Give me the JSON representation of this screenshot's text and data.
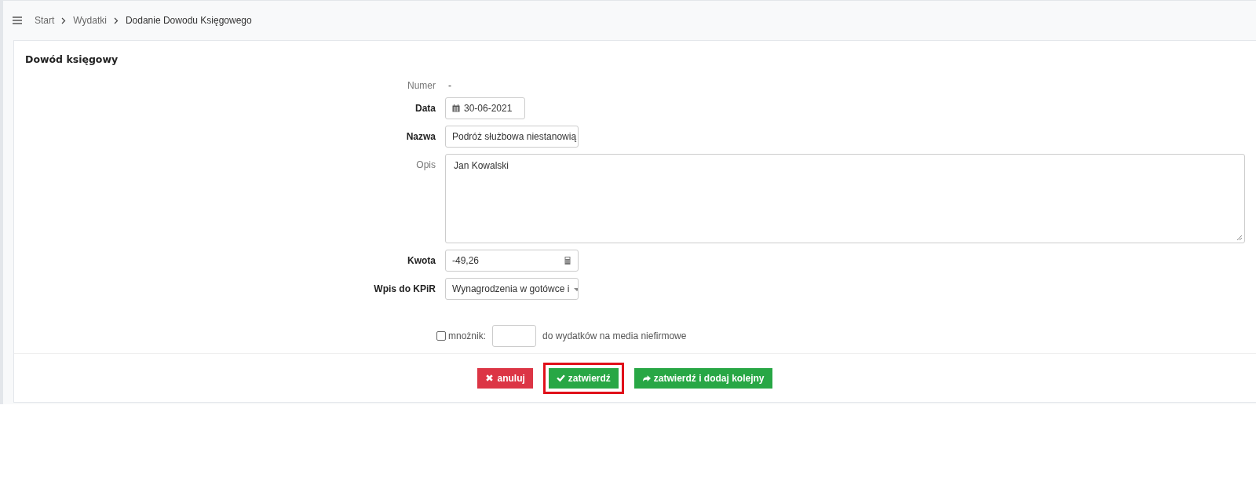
{
  "breadcrumb": [
    {
      "label": "Start",
      "current": false
    },
    {
      "label": "Wydatki",
      "current": false
    },
    {
      "label": "Dodanie Dowodu Księgowego",
      "current": true
    }
  ],
  "card": {
    "title": "Dowód księgowy",
    "fields": [
      {
        "kind": "static",
        "label": "Numer",
        "required": false,
        "value": "-"
      },
      {
        "kind": "date",
        "label": "Data",
        "required": true,
        "value": "30-06-2021"
      },
      {
        "kind": "text",
        "label": "Nazwa",
        "required": true,
        "value": "Podróż służbowa niestanowią"
      },
      {
        "kind": "textarea",
        "label": "Opis",
        "required": false,
        "value": "Jan Kowalski"
      },
      {
        "kind": "number",
        "label": "Kwota",
        "required": true,
        "value": "-49,26"
      },
      {
        "kind": "select",
        "label": "Wpis do KPiR",
        "required": true,
        "value": "Wynagrodzenia w gotówce i"
      }
    ],
    "multiplier": {
      "checked": false,
      "label": "mnożnik:",
      "suffix": "do wydatków na media niefirmowe"
    },
    "buttons": [
      {
        "kind": "cancel",
        "label": "anuluj",
        "highlighted": false
      },
      {
        "kind": "confirm",
        "label": "zatwierdź",
        "highlighted": true
      },
      {
        "kind": "confirm-next",
        "label": "zatwierdź i dodaj kolejny",
        "highlighted": false
      }
    ]
  }
}
